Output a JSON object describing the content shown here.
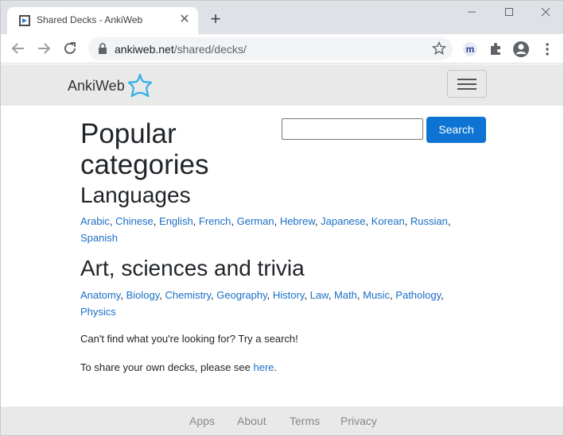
{
  "browser": {
    "tab_title": "Shared Decks - AnkiWeb",
    "url_domain": "ankiweb.net",
    "url_path": "/shared/decks/",
    "accent": "#1a73e8"
  },
  "site": {
    "brand": "AnkiWeb",
    "brand_icon": "star-outline-icon",
    "brand_color": "#3ab0e9"
  },
  "search": {
    "button_label": "Search",
    "value": "",
    "placeholder": ""
  },
  "main": {
    "title": "Popular categories",
    "sections": [
      {
        "title": "Languages",
        "links": [
          "Arabic",
          "Chinese",
          "English",
          "French",
          "German",
          "Hebrew",
          "Japanese",
          "Korean",
          "Russian",
          "Spanish"
        ]
      },
      {
        "title": "Art, sciences and trivia",
        "links": [
          "Anatomy",
          "Biology",
          "Chemistry",
          "Geography",
          "History",
          "Law",
          "Math",
          "Music",
          "Pathology",
          "Physics"
        ]
      }
    ],
    "hint_text": "Can't find what you're looking for? Try a search!",
    "share_text": "To share your own decks, please see ",
    "share_link": "here",
    "share_suffix": "."
  },
  "footer": {
    "links": [
      "Apps",
      "About",
      "Terms",
      "Privacy"
    ]
  }
}
